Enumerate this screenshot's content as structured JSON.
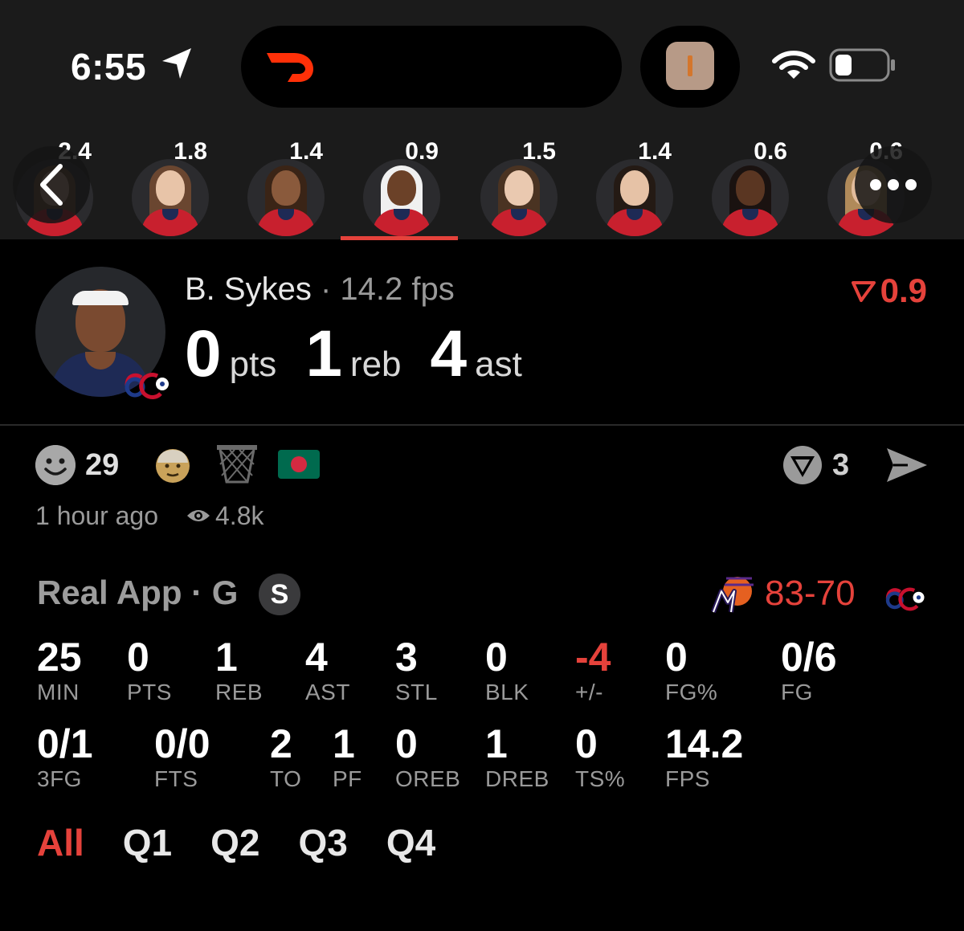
{
  "status_bar": {
    "time": "6:55"
  },
  "carousel": {
    "players": [
      {
        "value": "2.4",
        "skin": "#c9a28a",
        "hair": "#6b4a2e"
      },
      {
        "value": "1.8",
        "skin": "#e8c4a8",
        "hair": "#6a4630"
      },
      {
        "value": "1.4",
        "skin": "#8a5a3c",
        "hair": "#3a2416"
      },
      {
        "value": "0.9",
        "skin": "#6b4128",
        "hair": "#f0f0f0"
      },
      {
        "value": "1.5",
        "skin": "#eac9b0",
        "hair": "#4a3322"
      },
      {
        "value": "1.4",
        "skin": "#e6c2a6",
        "hair": "#241a14"
      },
      {
        "value": "0.6",
        "skin": "#5a3622",
        "hair": "#1a1210"
      },
      {
        "value": "0.6",
        "skin": "#e2bc9c",
        "hair": "#b08a5a"
      }
    ],
    "active_index": 3
  },
  "player": {
    "name": "B. Sykes",
    "fps": "· 14.2 fps",
    "delta": "0.9",
    "pts": "0",
    "pts_unit": "pts",
    "reb": "1",
    "reb_unit": "reb",
    "ast": "4",
    "ast_unit": "ast"
  },
  "social": {
    "reaction_count": "29",
    "vote_count": "3",
    "time_ago": "1 hour ago",
    "views": "4.8k"
  },
  "game": {
    "league": "Real App · G",
    "badge": "S",
    "score": "83-70"
  },
  "stats": [
    {
      "value": "25",
      "label": "MIN"
    },
    {
      "value": "0",
      "label": "PTS"
    },
    {
      "value": "1",
      "label": "REB"
    },
    {
      "value": "4",
      "label": "AST"
    },
    {
      "value": "3",
      "label": "STL"
    },
    {
      "value": "0",
      "label": "BLK"
    },
    {
      "value": "-4",
      "label": "+/-"
    },
    {
      "value": "0",
      "label": "FG%"
    },
    {
      "value": "0/6",
      "label": "FG"
    },
    {
      "value": "0/1",
      "label": "3FG"
    },
    {
      "value": "0/0",
      "label": "FTS"
    },
    {
      "value": "2",
      "label": "TO"
    },
    {
      "value": "1",
      "label": "PF"
    },
    {
      "value": "0",
      "label": "OREB"
    },
    {
      "value": "1",
      "label": "DREB"
    },
    {
      "value": "0",
      "label": "TS%"
    },
    {
      "value": "14.2",
      "label": "FPS"
    }
  ],
  "quarters": [
    "All",
    "Q1",
    "Q2",
    "Q3",
    "Q4"
  ],
  "colors": {
    "accent": "#e5423b",
    "background": "#000000",
    "header_bg": "#1b1b1b",
    "muted": "#9a9a9a"
  }
}
